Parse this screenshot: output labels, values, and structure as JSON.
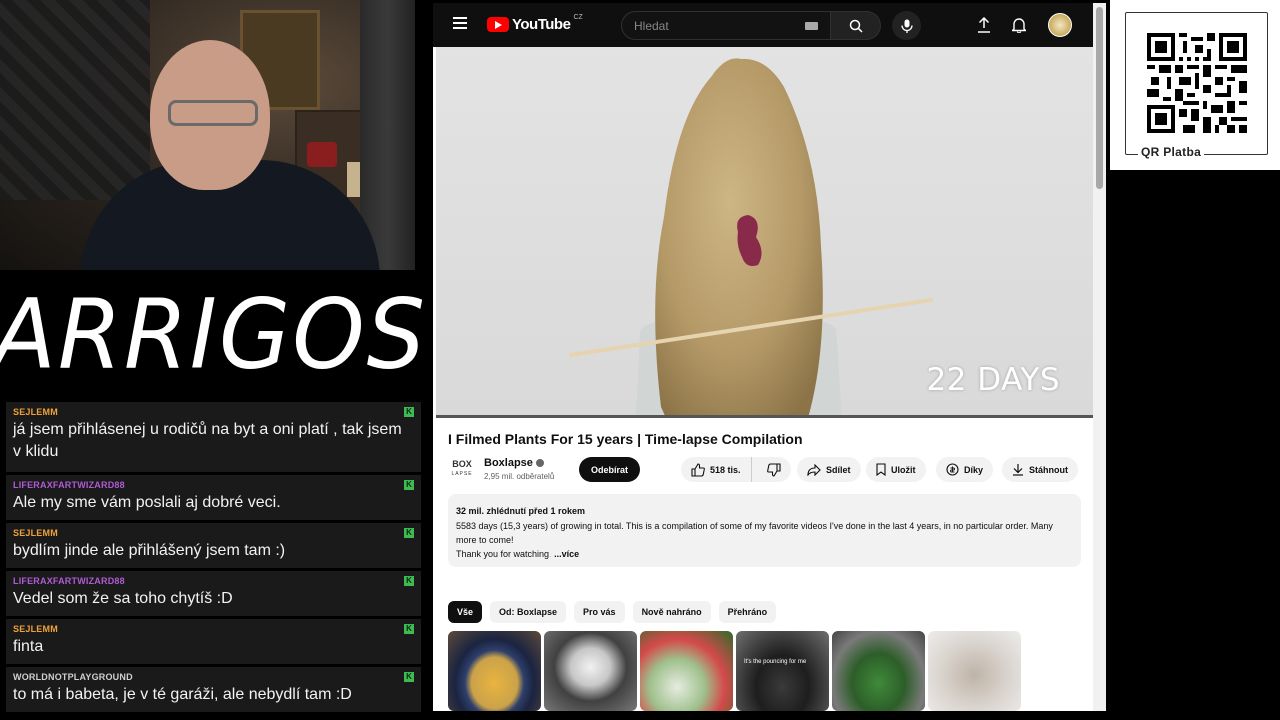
{
  "stream": {
    "logo_text": "ARRIGOS"
  },
  "chat": {
    "messages": [
      {
        "user": "SEJLEMM",
        "color": "#f0a23a",
        "text": "já jsem přihlásenej u rodičů na byt a oni platí , tak jsem v klidu"
      },
      {
        "user": "LIFERAXFARTWIZARD88",
        "color": "#b05bd4",
        "text": "Ale my sme vám poslali aj dobré veci."
      },
      {
        "user": "SEJLEMM",
        "color": "#f0a23a",
        "text": "bydlím jinde ale přihlášený jsem tam :)"
      },
      {
        "user": "LIFERAXFARTWIZARD88",
        "color": "#b05bd4",
        "text": "Vedel som že sa toho chytíš :D"
      },
      {
        "user": "SEJLEMM",
        "color": "#f0a23a",
        "text": "finta"
      },
      {
        "user": "WORLDNOTPLAYGROUND",
        "color": "#d0d0d0",
        "text": "to má i babeta, je v té garáži, ale nebydlí tam :D"
      }
    ],
    "badge_label": "K"
  },
  "youtube": {
    "brand": "YouTube",
    "country": "CZ",
    "search_placeholder": "Hledat",
    "video": {
      "overlay_text": "22 DAYS",
      "title": "I Filmed Plants For 15 years | Time-lapse Compilation"
    },
    "channel": {
      "logo_text": "BOX",
      "logo_sub": "LAPSE",
      "name": "Boxlapse",
      "subscribers": "2,95 mil. odběratelů",
      "subscribe_label": "Odebírat"
    },
    "actions": {
      "likes": "518 tis.",
      "share": "Sdílet",
      "save": "Uložit",
      "thanks": "Díky",
      "download": "Stáhnout"
    },
    "description": {
      "meta": "32 mil. zhlédnutí  před 1 rokem",
      "line1": "5583 days (15,3 years) of growing in total. This is a compilation of some of my favorite videos I've done in the last 4 years, in no particular order. Many more to come!",
      "line2": "Thank you for watching",
      "line2_fade": ".",
      "more": "...více"
    },
    "chips": [
      "Vše",
      "Od: Boxlapse",
      "Pro vás",
      "Nově nahráno",
      "Přehráno"
    ],
    "thumb_captions": [
      "",
      "",
      "",
      "It's the pouncing for me",
      "",
      ""
    ]
  },
  "qr": {
    "label": "QR Platba"
  },
  "colors": {
    "yt_red": "#ff0000",
    "chat_bg": "#1a1a1a",
    "mod_badge": "#3dbb52"
  }
}
